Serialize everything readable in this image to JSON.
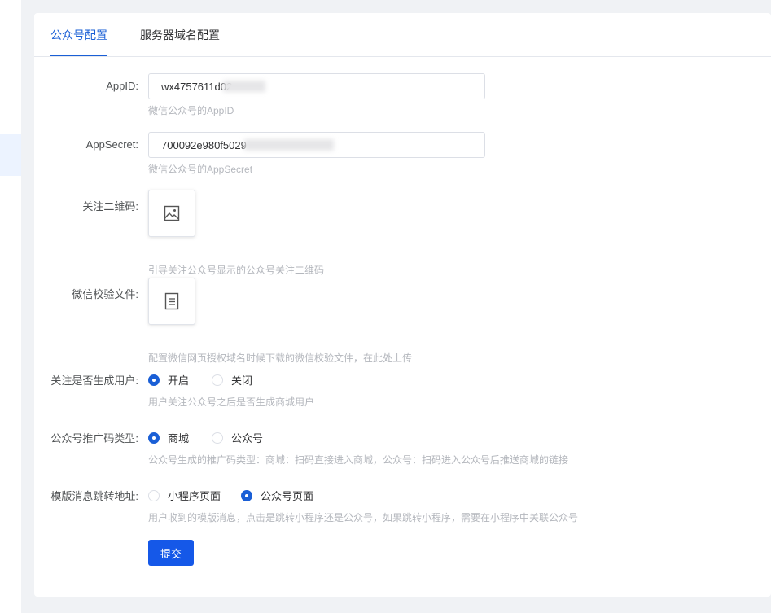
{
  "tabs": [
    {
      "label": "公众号配置",
      "active": true
    },
    {
      "label": "服务器域名配置",
      "active": false
    }
  ],
  "form": {
    "appid": {
      "label": "AppID:",
      "value": "wx4757611d02",
      "hint": "微信公众号的AppID"
    },
    "appsecret": {
      "label": "AppSecret:",
      "value": "700092e980f5029",
      "hint": "微信公众号的AppSecret"
    },
    "qrcode": {
      "label": "关注二维码:",
      "hint": "引导关注公众号显示的公众号关注二维码",
      "icon": "image-icon"
    },
    "verify_file": {
      "label": "微信校验文件:",
      "hint": "配置微信网页授权域名时候下载的微信校验文件，在此处上传",
      "icon": "document-icon"
    },
    "create_user": {
      "label": "关注是否生成用户:",
      "options": [
        {
          "label": "开启",
          "checked": true
        },
        {
          "label": "关闭",
          "checked": false
        }
      ],
      "hint": "用户关注公众号之后是否生成商城用户"
    },
    "promo_code_type": {
      "label": "公众号推广码类型:",
      "options": [
        {
          "label": "商城",
          "checked": true
        },
        {
          "label": "公众号",
          "checked": false
        }
      ],
      "hint": "公众号生成的推广码类型：商城：扫码直接进入商城，公众号：扫码进入公众号后推送商城的链接"
    },
    "template_jump": {
      "label": "模版消息跳转地址:",
      "options": [
        {
          "label": "小程序页面",
          "checked": false
        },
        {
          "label": "公众号页面",
          "checked": true
        }
      ],
      "hint": "用户收到的模版消息，点击是跳转小程序还是公众号，如果跳转小程序，需要在小程序中关联公众号"
    },
    "submit_label": "提交"
  },
  "colors": {
    "primary": "#1558e8",
    "tab_active": "#1a5fd6",
    "hint": "#b4b7bd"
  }
}
